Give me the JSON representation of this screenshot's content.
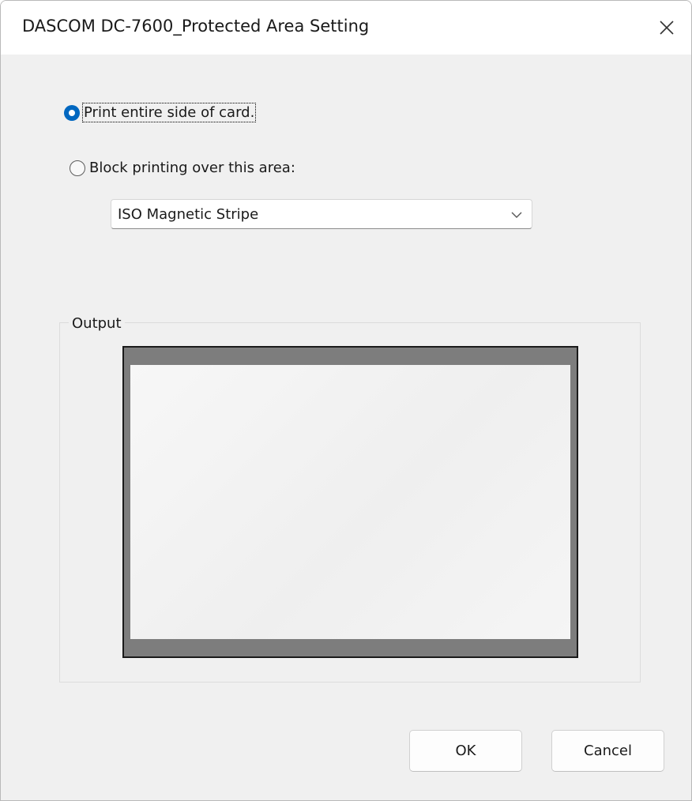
{
  "window": {
    "title": "DASCOM DC-7600_Protected Area Setting",
    "close_icon": "close-icon"
  },
  "options": {
    "print_entire": {
      "label": "Print entire side of card.",
      "checked": true
    },
    "block_printing": {
      "label": "Block printing over this area:",
      "checked": false
    }
  },
  "area_select": {
    "value": "ISO Magnetic Stripe",
    "icon": "chevron-down-icon"
  },
  "output": {
    "title": "Output"
  },
  "buttons": {
    "ok": "OK",
    "cancel": "Cancel"
  },
  "colors": {
    "accent": "#0067c0",
    "card_border": "#7d7d7d",
    "dialog_bg": "#f0f0f0"
  }
}
